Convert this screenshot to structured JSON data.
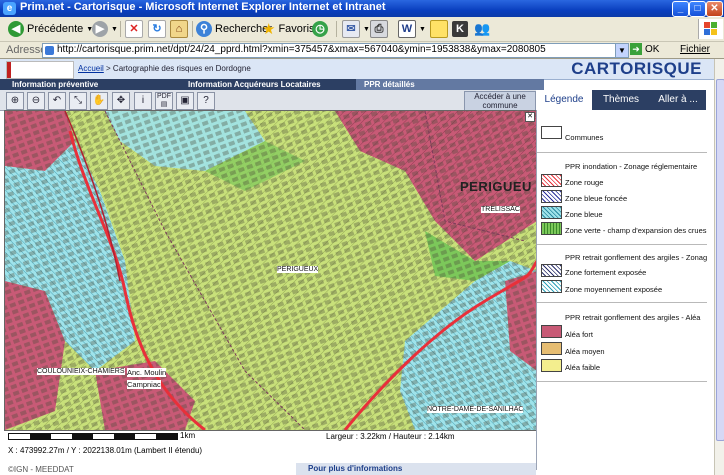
{
  "window": {
    "title": "Prim.net - Cartorisque - Microsoft Internet Explorer Internet et Intranet"
  },
  "toolbar": {
    "back_label": "Précédente",
    "search_label": "Rechercher",
    "favorites_label": "Favoris"
  },
  "address": {
    "label": "Adresse",
    "url": "http://cartorisque.prim.net/dpt/24/24_pprd.html?xmin=375457&xmax=567040&ymin=1953838&ymax=2080805",
    "go_label": "OK",
    "fichier_label": "Fichier"
  },
  "header": {
    "breadcrumb_home": "Accueil",
    "breadcrumb_rest": " > Cartographie des risques en Dordogne",
    "brand": "CARTORISQUE"
  },
  "tabs": [
    {
      "label": "Information préventive"
    },
    {
      "label": "Information Acquéreurs Locataires"
    },
    {
      "label": "PPR détaillés"
    }
  ],
  "tools": {
    "access_label": "Accéder à une commune"
  },
  "map": {
    "labels": {
      "perigueux_big": "PERIGUEU",
      "perigueux_small": "PERIGUEUX",
      "trelissac": "TRELISSAC",
      "coulounieix": "COULOUNIEIX-CHAMIERS",
      "anc_moulin": "Anc. Moulin",
      "campniac": "Campniac",
      "notre_dame": "NOTRE-DAME-DE-SANILHAC"
    }
  },
  "scale": {
    "label": "1km",
    "dims": "Largeur : 3.22km / Hauteur : 2.14km",
    "coords": "X : 473992.27m / Y : 2022138.01m (Lambert II étendu)"
  },
  "footer": {
    "left": "©IGN - MEEDDAT",
    "more": "Pour plus d'informations"
  },
  "panel": {
    "tabs": [
      {
        "label": "Légende"
      },
      {
        "label": "Thèmes"
      },
      {
        "label": "Aller à ..."
      }
    ]
  },
  "legend": {
    "communes": "Communes",
    "group1_title": "PPR inondation - Zonage réglementaire",
    "zone_rouge": "Zone rouge",
    "zone_bleue_foncee": "Zone bleue foncée",
    "zone_bleue": "Zone bleue",
    "zone_verte": "Zone verte - champ d'expansion des crues",
    "group2_title": "PPR retrait gonflement des argiles - Zonage",
    "zone_fortement": "Zone fortement exposée",
    "zone_moyennement": "Zone moyennement exposée",
    "group3_title": "PPR retrait gonflement des argiles - Aléa",
    "alea_fort": "Aléa fort",
    "alea_moyen": "Aléa moyen",
    "alea_faible": "Aléa faible"
  },
  "colors": {
    "alea_fort": "#c85a76",
    "alea_moyen": "#e6bd72",
    "alea_faible": "#f3ee8e",
    "zone_bleue": "#9fe3ea",
    "zone_rouge": "#e8303a",
    "zone_verte": "#7cc85a",
    "map_base": "#c8e07a"
  }
}
